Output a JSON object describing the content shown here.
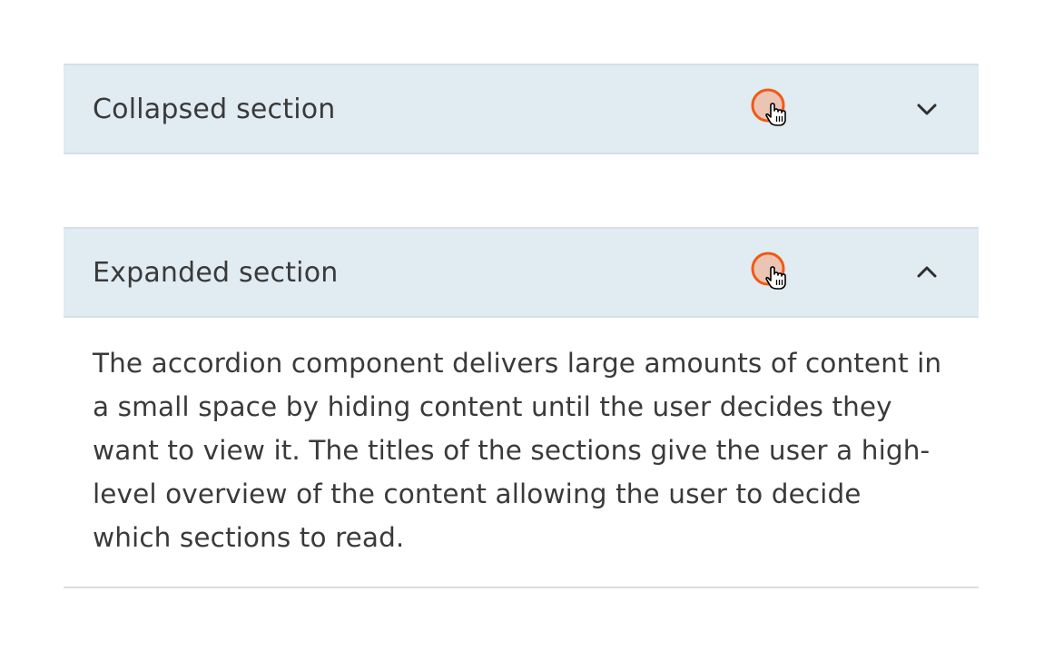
{
  "accordion": {
    "collapsed": {
      "title": "Collapsed section",
      "icon": "chevron-down-icon",
      "state": "collapsed"
    },
    "expanded": {
      "title": "Expanded section",
      "icon": "chevron-up-icon",
      "state": "expanded",
      "body": "The accordion component delivers large amounts of content in a small space by hiding content until the user decides they want to view it. The titles of the sections give the user a high-level overview of the content allowing the user to decide which sections to read."
    }
  },
  "colors": {
    "header_background": "#e0ebf2",
    "header_border": "#d6e0e6",
    "text": "#3a3a3a",
    "click_indicator": "#f05a14"
  }
}
